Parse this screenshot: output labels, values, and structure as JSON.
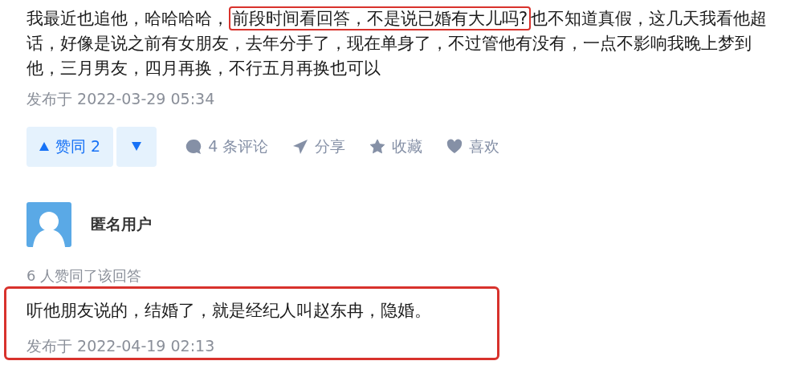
{
  "answer": {
    "text_before": "我最近也追他，哈哈哈哈，",
    "highlighted": "前段时间看回答，不是说已婚有大儿吗?",
    "text_after": "也不知道真假，这几天我看他超话，好像是说之前有女朋友，去年分手了，现在单身了，不过管他有没有，一点不影响我晚上梦到他，三月男友，四月再换，不行五月再换也可以",
    "published": "发布于 2022-03-29 05:34"
  },
  "actions": {
    "upvote": "赞同 2",
    "items": [
      {
        "kind": "comment",
        "label": "4 条评论"
      },
      {
        "kind": "share",
        "label": "分享"
      },
      {
        "kind": "favorite",
        "label": "收藏"
      },
      {
        "kind": "like",
        "label": "喜欢"
      }
    ]
  },
  "reply": {
    "author": "匿名用户",
    "upvotes_note": "6 人赞同了该回答",
    "text": "听他朋友说的，结婚了，就是经纪人叫赵东冉，隐婚。",
    "published": "发布于 2022-04-19 02:13"
  }
}
